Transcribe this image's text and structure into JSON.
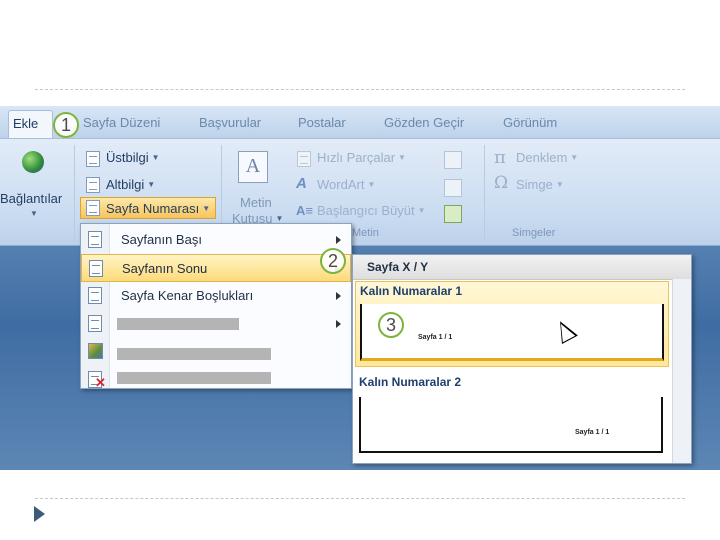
{
  "tabs": [
    "Ekle",
    "Sayfa Düzeni",
    "Başvurular",
    "Postalar",
    "Gözden Geçir",
    "Görünüm"
  ],
  "ribbon": {
    "baglantilar": "Bağlantılar",
    "ustbilgi": "Üstbilgi",
    "altbilgi": "Altbilgi",
    "sayfa_numarasi": "Sayfa Numarası",
    "metin_kutusu_line1": "Metin",
    "metin_kutusu_line2": "Kutusu",
    "hizli_parcalar": "Hızlı Parçalar",
    "wordart": "WordArt",
    "baslangici_buyut": "Başlangıcı Büyüt",
    "metin_group": "Metin",
    "denklem": "Denklem",
    "simge": "Simge",
    "simgeler_group": "Simgeler",
    "dropdown_arrow": "▾"
  },
  "menu": {
    "items": [
      {
        "label": "Sayfanın Başı",
        "submenu": true
      },
      {
        "label": "Sayfanın Sonu",
        "submenu": true,
        "highlighted": true
      },
      {
        "label": "Sayfa Kenar Boşlukları",
        "submenu": true
      },
      {
        "label": "",
        "submenu": true
      }
    ]
  },
  "gallery": {
    "header": "Sayfa X / Y",
    "options": [
      {
        "title": "Kalın Numaralar 1",
        "preview_text": "Sayfa 1 / 1",
        "selected": true
      },
      {
        "title": "Kalın Numaralar 2",
        "preview_text": "Sayfa 1 / 1",
        "selected": false
      }
    ]
  },
  "callouts": [
    "1",
    "2",
    "3"
  ],
  "colors": {
    "highlight": "#fddb7a",
    "callout_border": "#7fb33a",
    "background_blue": "#3f6ca2"
  }
}
